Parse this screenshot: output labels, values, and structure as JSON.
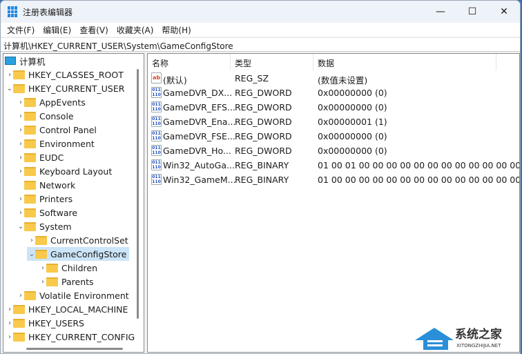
{
  "window": {
    "title": "注册表编辑器",
    "minimize": "—",
    "maximize": "☐",
    "close": "✕"
  },
  "menu": [
    "文件(F)",
    "编辑(E)",
    "查看(V)",
    "收藏夹(A)",
    "帮助(H)"
  ],
  "address": "计算机\\HKEY_CURRENT_USER\\System\\GameConfigStore",
  "tree": [
    {
      "label": "计算机",
      "level": 0,
      "chevron": "",
      "root": true
    },
    {
      "label": "HKEY_CLASSES_ROOT",
      "level": 0,
      "chevron": "›"
    },
    {
      "label": "HKEY_CURRENT_USER",
      "level": 0,
      "chevron": "⌄"
    },
    {
      "label": "AppEvents",
      "level": 1,
      "chevron": "›"
    },
    {
      "label": "Console",
      "level": 1,
      "chevron": "›"
    },
    {
      "label": "Control Panel",
      "level": 1,
      "chevron": "›"
    },
    {
      "label": "Environment",
      "level": 1,
      "chevron": "›"
    },
    {
      "label": "EUDC",
      "level": 1,
      "chevron": "›"
    },
    {
      "label": "Keyboard Layout",
      "level": 1,
      "chevron": "›"
    },
    {
      "label": "Network",
      "level": 1,
      "chevron": ""
    },
    {
      "label": "Printers",
      "level": 1,
      "chevron": "›"
    },
    {
      "label": "Software",
      "level": 1,
      "chevron": "›"
    },
    {
      "label": "System",
      "level": 1,
      "chevron": "⌄"
    },
    {
      "label": "CurrentControlSet",
      "level": 2,
      "chevron": "›"
    },
    {
      "label": "GameConfigStore",
      "level": 2,
      "chevron": "⌄",
      "selected": true
    },
    {
      "label": "Children",
      "level": 3,
      "chevron": "›"
    },
    {
      "label": "Parents",
      "level": 3,
      "chevron": "›"
    },
    {
      "label": "Volatile Environment",
      "level": 1,
      "chevron": "›"
    },
    {
      "label": "HKEY_LOCAL_MACHINE",
      "level": 0,
      "chevron": "›"
    },
    {
      "label": "HKEY_USERS",
      "level": 0,
      "chevron": "›"
    },
    {
      "label": "HKEY_CURRENT_CONFIG",
      "level": 0,
      "chevron": "›"
    }
  ],
  "columns": {
    "name": "名称",
    "type": "类型",
    "data": "数据"
  },
  "values": [
    {
      "icon": "string-value-icon",
      "name": "(默认)",
      "type": "REG_SZ",
      "data": "(数值未设置)"
    },
    {
      "icon": "binary-value-icon",
      "name": "GameDVR_DX...",
      "type": "REG_DWORD",
      "data": "0x00000000 (0)"
    },
    {
      "icon": "binary-value-icon",
      "name": "GameDVR_EFS...",
      "type": "REG_DWORD",
      "data": "0x00000000 (0)"
    },
    {
      "icon": "binary-value-icon",
      "name": "GameDVR_Ena...",
      "type": "REG_DWORD",
      "data": "0x00000001 (1)"
    },
    {
      "icon": "binary-value-icon",
      "name": "GameDVR_FSE...",
      "type": "REG_DWORD",
      "data": "0x00000000 (0)"
    },
    {
      "icon": "binary-value-icon",
      "name": "GameDVR_Ho...",
      "type": "REG_DWORD",
      "data": "0x00000000 (0)"
    },
    {
      "icon": "binary-value-icon",
      "name": "Win32_AutoGa...",
      "type": "REG_BINARY",
      "data": "01 00 01 00 00 00 00 00 00 00 00 00 00 00 00..."
    },
    {
      "icon": "binary-value-icon",
      "name": "Win32_GameM...",
      "type": "REG_BINARY",
      "data": "01 00 00 00 00 00 00 00 00 00 00 00 00 00 00..."
    }
  ],
  "watermark": {
    "text": "系统之家",
    "sub": "XITONGZHIJIA.NET"
  }
}
